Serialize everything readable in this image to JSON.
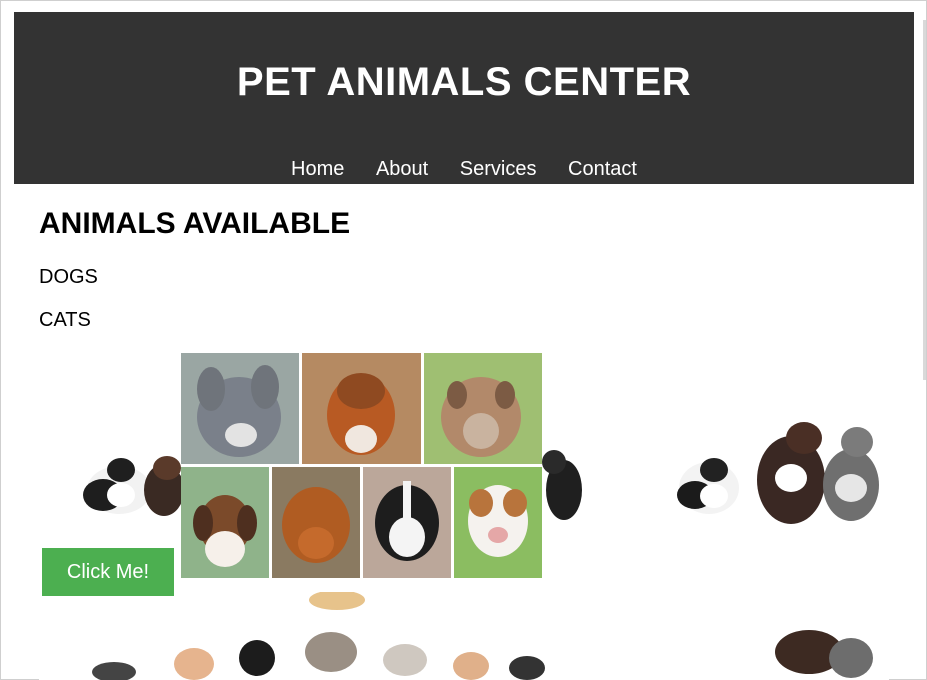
{
  "site": {
    "title": "PET ANIMALS CENTER"
  },
  "nav": [
    "Home",
    "About",
    "Services",
    "Contact"
  ],
  "main": {
    "heading": "ANIMALS AVAILABLE",
    "items": [
      "DOGS",
      "CATS"
    ],
    "button_label": "Click Me!"
  },
  "colors": {
    "header_bg": "#333333",
    "button_bg": "#4CAF50",
    "text": "#000000"
  }
}
